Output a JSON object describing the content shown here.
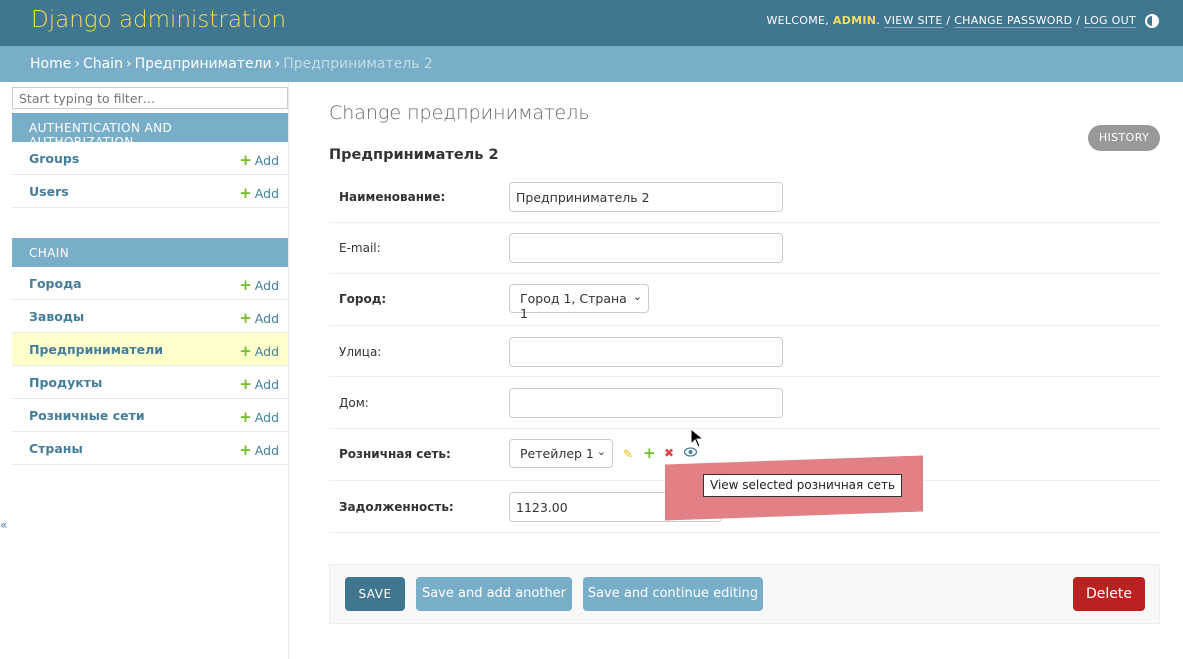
{
  "header": {
    "site_name": "Django administration",
    "welcome": "WELCOME, ",
    "username": "ADMIN",
    "view_site": "VIEW SITE",
    "change_password": "CHANGE PASSWORD",
    "log_out": "LOG OUT"
  },
  "breadcrumbs": [
    "Home",
    "Chain",
    "Предприниматели",
    "Предприниматель 2"
  ],
  "sidebar": {
    "filter_placeholder": "Start typing to filter…",
    "apps": [
      {
        "caption": "AUTHENTICATION AND AUTHORIZATION",
        "models": [
          {
            "name": "Groups",
            "add": "Add"
          },
          {
            "name": "Users",
            "add": "Add"
          }
        ]
      },
      {
        "caption": "CHAIN",
        "models": [
          {
            "name": "Города",
            "add": "Add"
          },
          {
            "name": "Заводы",
            "add": "Add"
          },
          {
            "name": "Предприниматели",
            "add": "Add"
          },
          {
            "name": "Продукты",
            "add": "Add"
          },
          {
            "name": "Розничные сети",
            "add": "Add"
          },
          {
            "name": "Страны",
            "add": "Add"
          }
        ]
      }
    ],
    "collapse": "«"
  },
  "content": {
    "title": "Change предприниматель",
    "history": "HISTORY",
    "object_title": "Предприниматель 2"
  },
  "form": {
    "name": {
      "label": "Наименование:",
      "value": "Предприниматель 2"
    },
    "email": {
      "label": "E-mail:",
      "value": ""
    },
    "city": {
      "label": "Город:",
      "value": "Город 1, Страна 1"
    },
    "street": {
      "label": "Улица:",
      "value": ""
    },
    "house": {
      "label": "Дом:",
      "value": ""
    },
    "retail": {
      "label": "Розничная сеть:",
      "value": "Ретейлер 1"
    },
    "debt": {
      "label": "Задолженность:",
      "value": "1123.00"
    }
  },
  "tooltip": "View selected розничная сеть",
  "submit": {
    "save": "SAVE",
    "save_add": "Save and add another",
    "save_continue": "Save and continue editing",
    "delete": "Delete"
  },
  "colors": {
    "header_bg": "#417690",
    "breadcrumbs_bg": "#79aec8",
    "accent_yellow": "#f5dd5d",
    "delete_red": "#ba2121"
  }
}
